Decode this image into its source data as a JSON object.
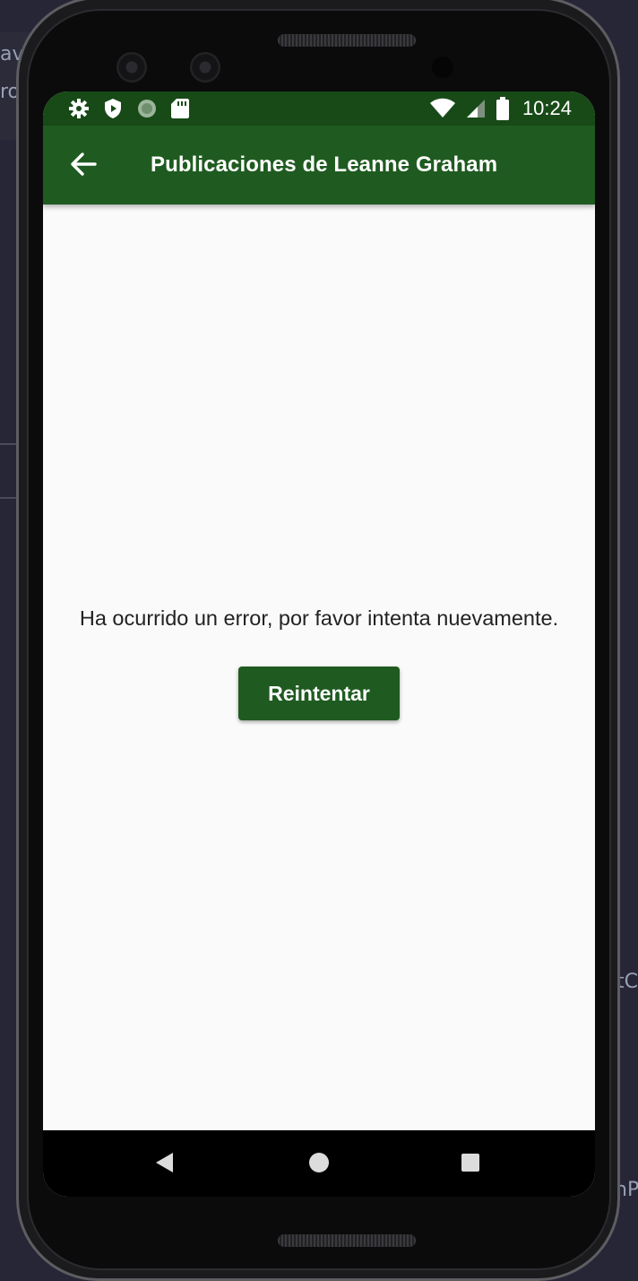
{
  "status_bar": {
    "time": "10:24",
    "left_icons": [
      "settings-icon",
      "shield-icon",
      "sync-icon",
      "sd-card-icon"
    ],
    "right_icons": [
      "wifi-icon",
      "signal-icon",
      "battery-icon"
    ]
  },
  "app_bar": {
    "title": "Publicaciones de Leanne Graham",
    "back_icon": "arrow-back-icon",
    "color": "#1f5b20"
  },
  "content": {
    "error_message": "Ha ocurrido un error, por favor intenta nuevamente.",
    "retry_label": "Reintentar"
  },
  "nav_bar": {
    "items": [
      "back-triangle-icon",
      "home-circle-icon",
      "recents-square-icon"
    ]
  },
  "background": {
    "fragments": [
      "av",
      "ro",
      "tC",
      "nP"
    ]
  }
}
